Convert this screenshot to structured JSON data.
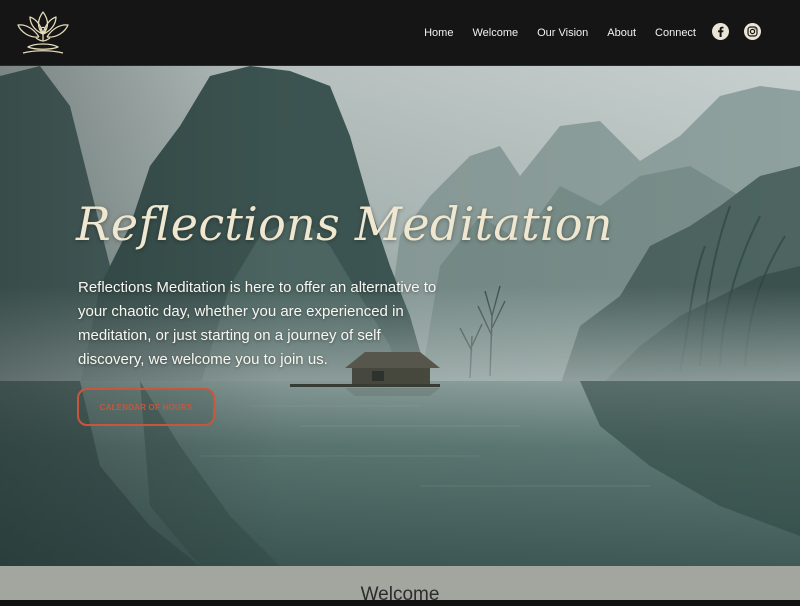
{
  "header": {
    "logo_icon": "lotus-meditation-icon",
    "nav": [
      {
        "label": "Home"
      },
      {
        "label": "Welcome"
      },
      {
        "label": "Our Vision"
      },
      {
        "label": "About"
      },
      {
        "label": "Connect"
      }
    ],
    "social": [
      {
        "icon": "facebook-icon"
      },
      {
        "icon": "instagram-icon"
      }
    ]
  },
  "hero": {
    "title": "Reflections Meditation",
    "description": "Reflections Meditation is here to offer an alternative to your chaotic day, whether you are experienced in meditation, or just starting on a journey of self discovery, we welcome you to join us.",
    "cta_label": "CALENDAR OF HOURS"
  },
  "welcome": {
    "title": "Welcome"
  },
  "colors": {
    "header_bg": "#151515",
    "accent": "#c8563c",
    "title_cream": "#efe7cf",
    "welcome_bg": "#a3a69f"
  }
}
